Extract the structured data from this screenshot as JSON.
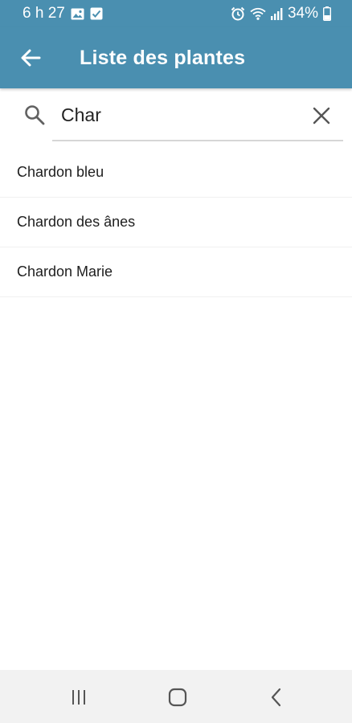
{
  "status_bar": {
    "time": "6 h 27",
    "battery": "34%",
    "icons": [
      "image-icon",
      "checkbox-icon",
      "alarm-icon",
      "wifi-icon",
      "signal-icon",
      "battery-icon"
    ]
  },
  "app_bar": {
    "title": "Liste des plantes",
    "back_icon": "arrow-left-icon"
  },
  "search": {
    "value": "Char",
    "icon": "search-icon",
    "clear_icon": "close-icon"
  },
  "results": [
    {
      "label": "Chardon bleu"
    },
    {
      "label": "Chardon des ânes"
    },
    {
      "label": "Chardon Marie"
    }
  ],
  "nav_bar": {
    "icons": [
      "recent-apps-icon",
      "home-icon",
      "back-icon"
    ]
  },
  "colors": {
    "primary": "#4a8fb0",
    "background": "#ffffff",
    "nav_bar": "#f2f2f2",
    "text": "#1e1e1e"
  }
}
